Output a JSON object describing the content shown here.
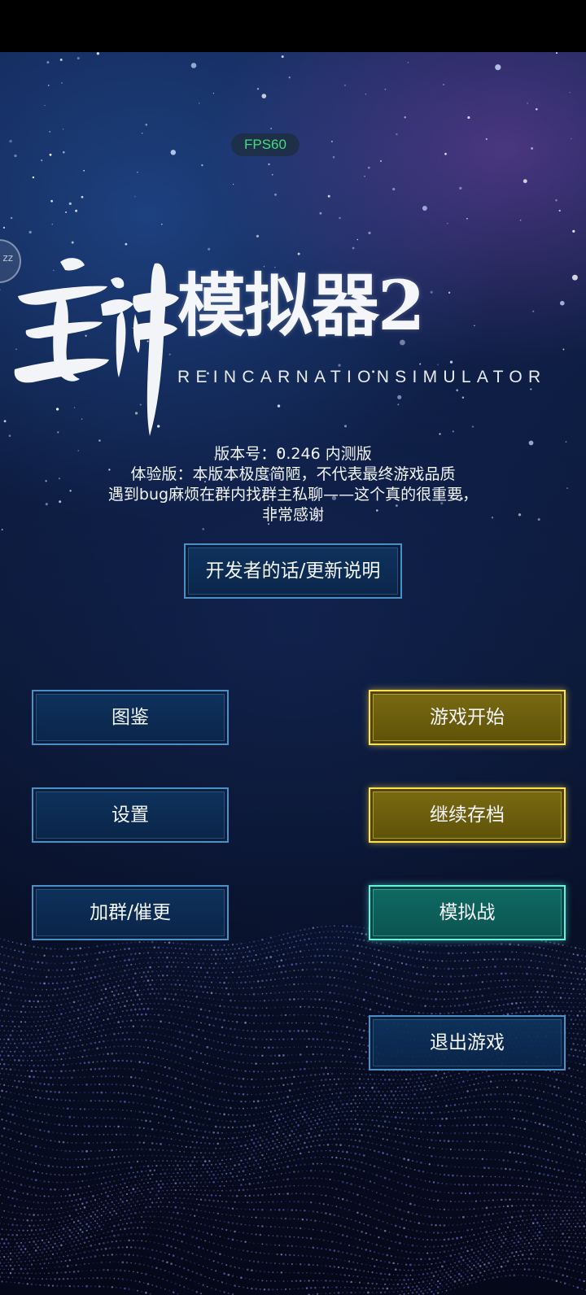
{
  "hud": {
    "fps": "FPS60",
    "float_ball_label": "zz"
  },
  "logo": {
    "calligraphy": "主神",
    "title": "模拟器2",
    "subtitle": "REINCARNATIONSIMULATOR"
  },
  "notice": {
    "version": "版本号：0.246 内测版",
    "line2": "体验版：本版本极度简陋，不代表最终游戏品质",
    "line3": "遇到bug麻烦在群内找群主私聊——这个真的很重要，",
    "line4": "非常感谢"
  },
  "menu": {
    "dev_notes": "开发者的话/更新说明",
    "gallery": "图鉴",
    "start": "游戏开始",
    "settings": "设置",
    "continue": "继续存档",
    "join_group": "加群/催更",
    "sim_battle": "模拟战",
    "exit": "退出游戏"
  },
  "colors": {
    "fps_green": "#3ee07a",
    "blue_border": "#4a8fc6",
    "gold_border": "#ffe24a",
    "teal_border": "#5ff3e0"
  }
}
